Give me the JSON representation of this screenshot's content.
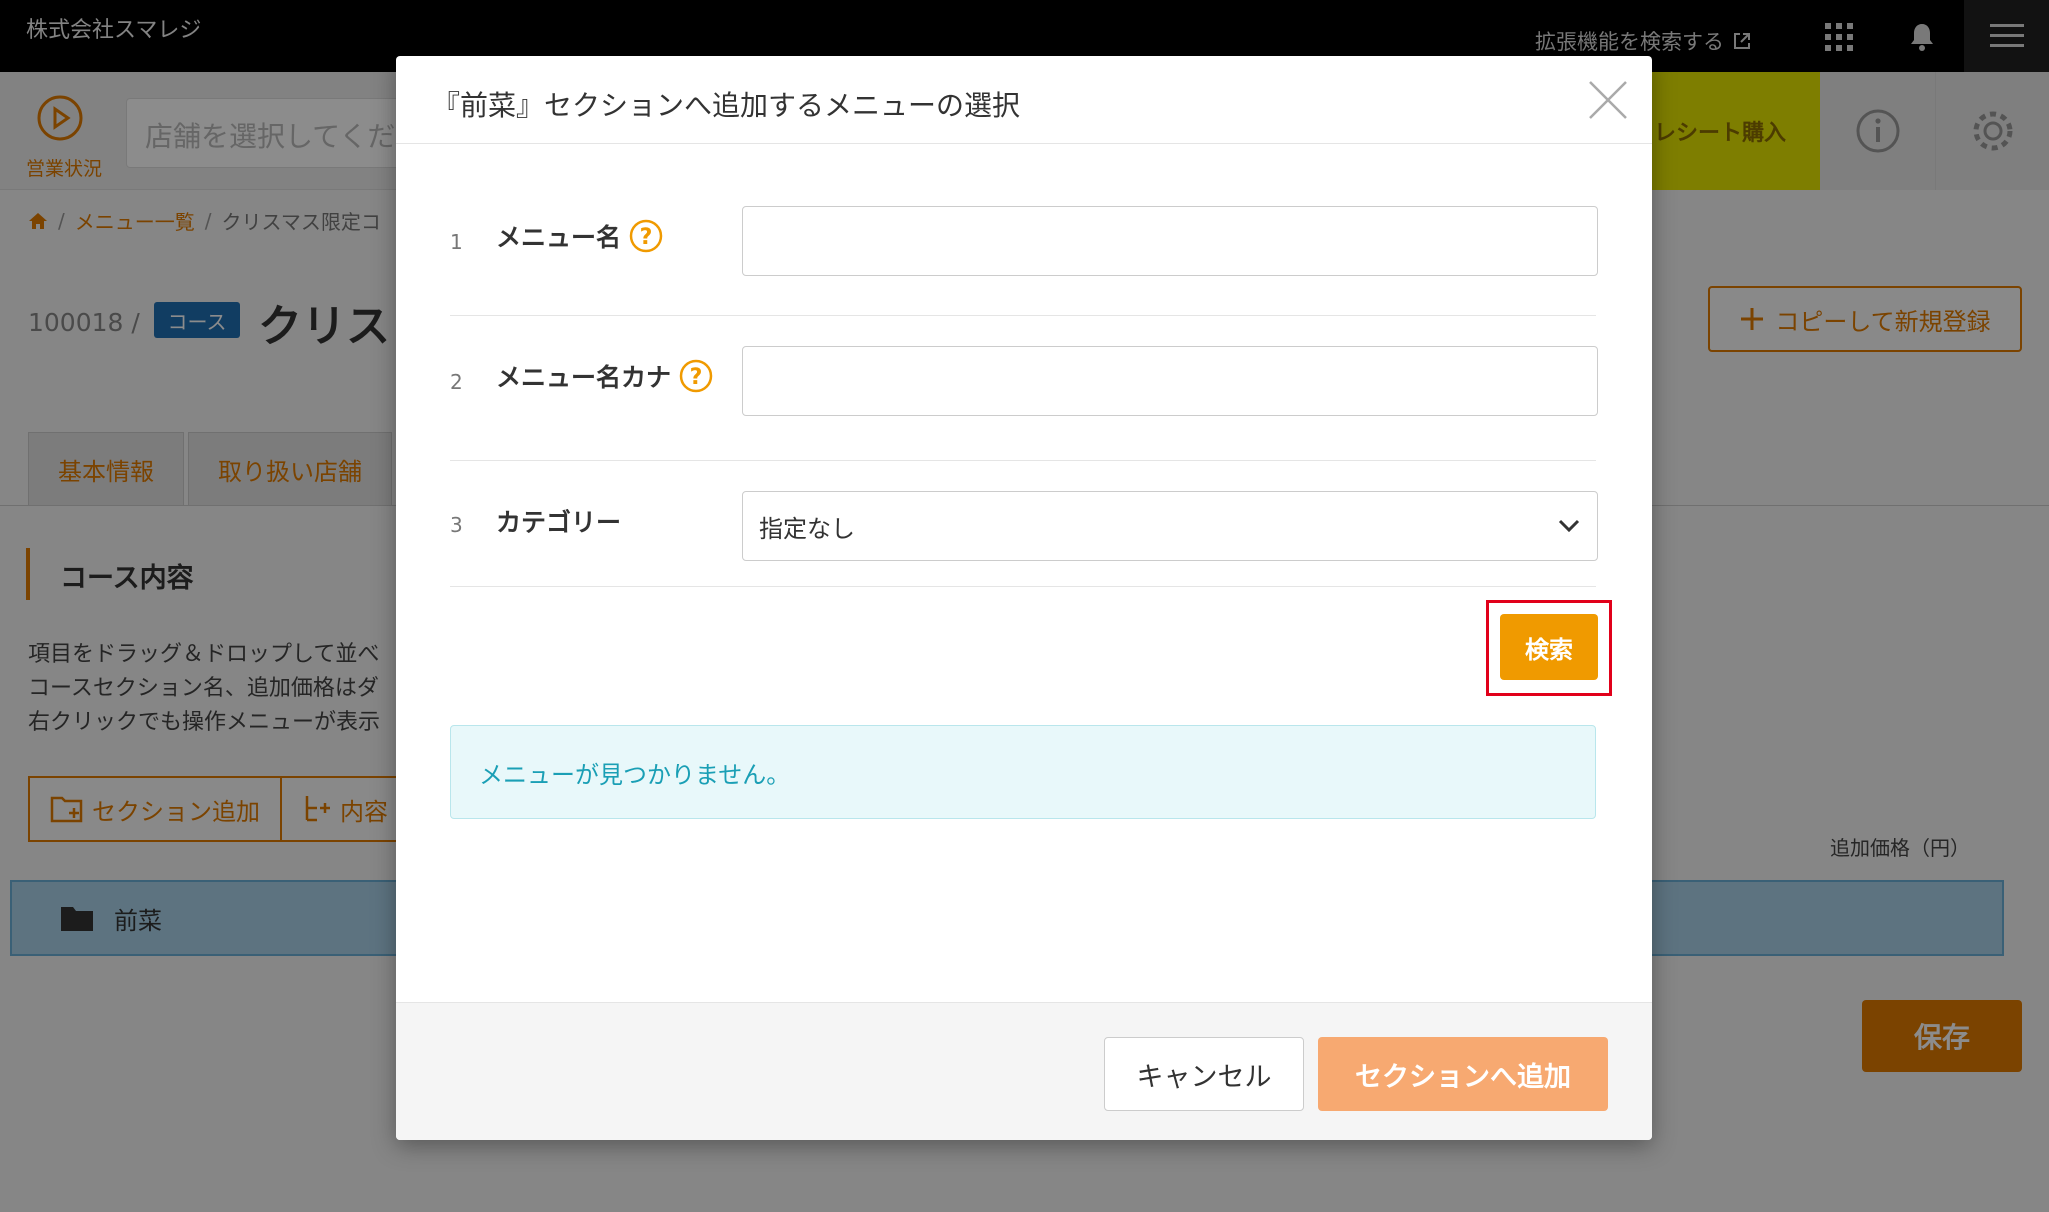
{
  "topbar": {
    "company": "株式会社スマレジ",
    "extension_link": "拡張機能を検索する"
  },
  "subbar": {
    "status_label": "営業状況",
    "store_placeholder": "店舗を選択してくだ",
    "receipt_button": "レシート購入"
  },
  "breadcrumb": {
    "items": [
      "メニュー一覧",
      "クリスマス限定コ"
    ]
  },
  "page": {
    "code": "100018 /",
    "badge": "コース",
    "title": "クリス",
    "copy_button": "コピーして新規登録",
    "tabs": [
      "基本情報",
      "取り扱い店舗"
    ],
    "section_title": "コース内容",
    "help_lines": [
      "項目をドラッグ＆ドロップして並べ",
      "コースセクション名、追加価格はダ",
      "右クリックでも操作メニューが表示"
    ],
    "add_section_button": "セクション追加",
    "add_content_button": "内容",
    "price_label": "追加価格（円）",
    "course_row_label": "前菜",
    "save_button": "保存"
  },
  "modal": {
    "title": "『前菜』セクションへ追加するメニューの選択",
    "rows": [
      {
        "num": "1",
        "label": "メニュー名"
      },
      {
        "num": "2",
        "label": "メニュー名カナ"
      },
      {
        "num": "3",
        "label": "カテゴリー"
      }
    ],
    "category_value": "指定なし",
    "search_button": "検索",
    "notice": "メニューが見つかりません。",
    "cancel_button": "キャンセル",
    "add_button": "セクションへ追加"
  },
  "colors": {
    "accent": "#e07b00",
    "search_orange": "#f09a00",
    "add_button": "#f7a971",
    "notice_text": "#1a9fb5",
    "highlight": "#e1001a"
  }
}
